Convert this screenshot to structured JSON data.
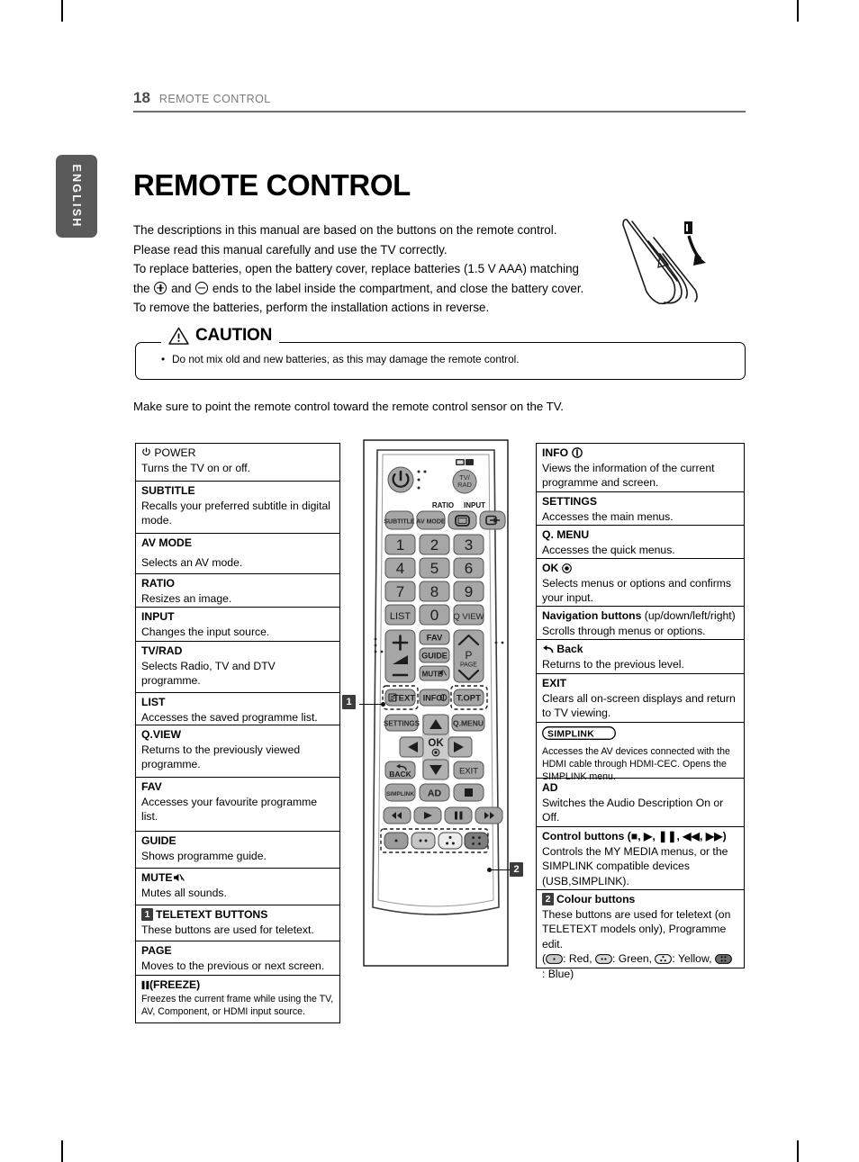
{
  "header": {
    "page_number": "18",
    "breadcrumb": "REMOTE CONTROL"
  },
  "language_tab": "ENGLISH",
  "title": "REMOTE CONTROL",
  "intro": {
    "line1": "The descriptions in this manual are based on the buttons on the remote control.",
    "line2": "Please read this manual carefully and use the TV correctly.",
    "line3": "To replace batteries, open the battery cover, replace batteries (1.5 V AAA) matching",
    "line4a": "the",
    "line4b": "and",
    "line4c": "ends to the label inside the compartment, and close the battery cover.",
    "line5": "To remove the batteries, perform the installation actions in reverse."
  },
  "caution": {
    "title": "CAUTION",
    "icon": "warning-triangle-icon",
    "bullet": "Do not mix old and new batteries, as this may damage the remote control."
  },
  "sensor_note": "Make sure to point the remote control toward the remote control sensor on the TV.",
  "left_table": [
    {
      "title": "POWER",
      "icon": "power-icon",
      "desc": "Turns the TV on or off."
    },
    {
      "title": "SUBTITLE",
      "desc": "Recalls your preferred subtitle in digital mode."
    },
    {
      "title": "AV MODE",
      "desc": "Selects an AV mode."
    },
    {
      "title": "RATIO",
      "desc": "Resizes an image."
    },
    {
      "title": "INPUT",
      "desc": "Changes the input source."
    },
    {
      "title": "TV/RAD",
      "desc": "Selects Radio, TV and DTV programme."
    },
    {
      "title": "LIST",
      "desc": "Accesses the saved  programme list."
    },
    {
      "title": "Q.VIEW",
      "desc": "Returns to the previously viewed programme."
    },
    {
      "title": "FAV",
      "desc": "Accesses your favourite programme list."
    },
    {
      "title": "GUIDE",
      "desc": "Shows programme guide."
    },
    {
      "title": "MUTE",
      "icon": "mute-icon",
      "desc": "Mutes all sounds."
    },
    {
      "title": "TELETEXT BUTTONS",
      "marker": "1",
      "desc": "These buttons are used for teletext."
    },
    {
      "title": "PAGE",
      "desc": "Moves to the previous or next screen."
    },
    {
      "title": "(FREEZE)",
      "icon": "pause-icon",
      "desc": "Freezes the current frame while using the TV, AV, Component, or HDMI input source."
    }
  ],
  "right_table": [
    {
      "title": "INFO",
      "icon": "info-icon",
      "desc": "Views the information of the current programme and screen."
    },
    {
      "title": "SETTINGS",
      "desc": "Accesses the main menus."
    },
    {
      "title": "Q. MENU",
      "desc": "Accesses the quick menus."
    },
    {
      "title": "OK",
      "icon": "ok-icon",
      "desc": "Selects menus or options and confirms your input."
    },
    {
      "title": "Navigation buttons",
      "title_suffix": " (up/down/left/right)",
      "desc": "Scrolls through menus or options."
    },
    {
      "title": "Back",
      "icon": "back-arrow-icon",
      "desc": "Returns to the previous level."
    },
    {
      "title": "EXIT",
      "desc": "Clears all on-screen displays and return to TV viewing."
    },
    {
      "title": "SIMPLINK",
      "icon": "simplink-logo",
      "desc": "Accesses the AV devices connected with the HDMI cable through HDMI-CEC. Opens the SIMPLINK menu."
    },
    {
      "title": "AD",
      "desc": "Switches the Audio Description On or Off."
    },
    {
      "title": "Control buttons",
      "title_suffix": " (■, ▶, ❚❚, ◀◀, ▶▶)",
      "desc": "Controls the MY MEDIA menus, or the SIMPLINK compatible devices (USB,SIMPLINK)."
    },
    {
      "title": "Colour buttons",
      "marker": "2",
      "desc": "These buttons are used for teletext (on TELETEXT models only), Programme edit.",
      "desc2": ": Red,",
      "desc3": ": Green,",
      "desc4": ": Yellow,",
      "desc5": ": Blue)"
    }
  ],
  "remote": {
    "callout_1": "1",
    "callout_2": "2",
    "buttons": {
      "power": "power-icon",
      "tv_rad_top": "TV/",
      "tv_rad_bottom": "RAD",
      "tv_rad_label": "tv-radio-icon",
      "subtitle": "SUBTITLE",
      "av_mode": "AV MODE",
      "ratio_label": "RATIO",
      "input_label": "INPUT",
      "digits": [
        "1",
        "2",
        "3",
        "4",
        "5",
        "6",
        "7",
        "8",
        "9"
      ],
      "list": "LIST",
      "zero": "0",
      "qview": "Q VIEW",
      "vol_plus": "+",
      "vol_minus": "−",
      "fav": "FAV",
      "guide": "GUIDE",
      "mute": "MUTE",
      "p": "P",
      "page": "PAGE",
      "text": "TEXT",
      "info": "INFO",
      "topt": "T.OPT",
      "settings": "SETTINGS",
      "qmenu": "Q.MENU",
      "ok": "OK",
      "back": "BACK",
      "exit": "EXIT",
      "simplink": "SIMPLINK",
      "ad": "AD"
    }
  },
  "colors": {
    "tab_grey": "#5a5a5a",
    "marker_grey": "#3c3c3c",
    "rule_grey": "#6d6d6d",
    "button_grey": "#a8a8a8",
    "remote_body": "#ffffff"
  }
}
